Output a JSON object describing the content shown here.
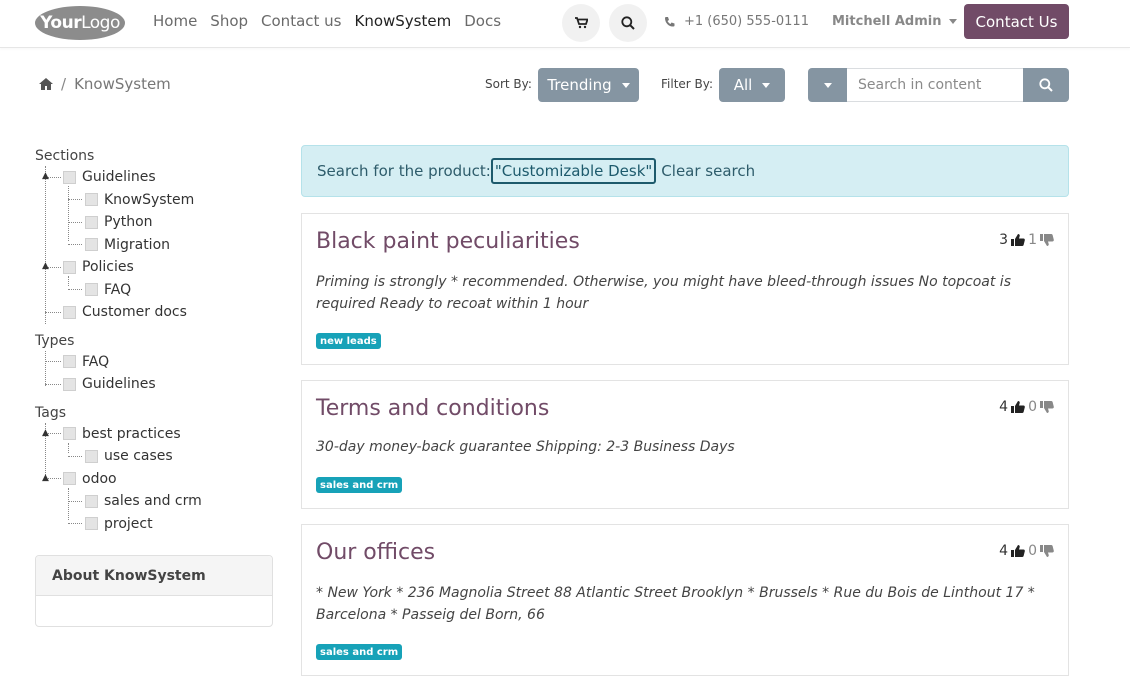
{
  "logo": {
    "bold": "Your",
    "light": "Logo"
  },
  "nav": {
    "items": [
      "Home",
      "Shop",
      "Contact us",
      "KnowSystem",
      "Docs"
    ],
    "active": "KnowSystem"
  },
  "header": {
    "phone": "+1 (650) 555-0111",
    "user": "Mitchell Admin",
    "contact_button": "Contact Us"
  },
  "breadcrumb": {
    "current": "KnowSystem"
  },
  "toolbar": {
    "sort_label": "Sort By:",
    "sort_value": "Trending",
    "filter_label": "Filter By:",
    "filter_value": "All",
    "search_placeholder": "Search in content"
  },
  "sidebar": {
    "sections_title": "Sections",
    "sections": {
      "guidelines": "Guidelines",
      "knowsystem": "KnowSystem",
      "python": "Python",
      "migration": "Migration",
      "policies": "Policies",
      "faq": "FAQ",
      "customer_docs": "Customer docs"
    },
    "types_title": "Types",
    "types": {
      "faq": "FAQ",
      "guidelines": "Guidelines"
    },
    "tags_title": "Tags",
    "tags": {
      "best_practices": "best practices",
      "use_cases": "use cases",
      "odoo": "odoo",
      "sales_crm": "sales and crm",
      "project": "project"
    },
    "about_title": "About KnowSystem"
  },
  "alert": {
    "prefix": "Search for the product:",
    "term": "\"Customizable Desk\"",
    "clear": "Clear search"
  },
  "articles": [
    {
      "title": "Black paint peculiarities",
      "likes": "3",
      "dislikes": "1",
      "text": "Priming is strongly * recommended. Otherwise, you might have bleed-through issues No topcoat is required Ready to recoat within 1 hour",
      "tag": "new leads"
    },
    {
      "title": "Terms and conditions",
      "likes": "4",
      "dislikes": "0",
      "text": "30-day money-back guarantee Shipping: 2-3 Business Days",
      "tag": "sales and crm"
    },
    {
      "title": "Our offices",
      "likes": "4",
      "dislikes": "0",
      "text": "* New York * 236 Magnolia Street 88 Atlantic Street Brooklyn * Brussels * Rue du Bois de Linthout 17 * Barcelona * Passeig del Born, 66",
      "tag": "sales and crm"
    }
  ],
  "colors": {
    "brand": "#714B67",
    "grey_button": "#8595a2",
    "alert_bg": "#d5eef3",
    "tag": "#17a2b8"
  }
}
